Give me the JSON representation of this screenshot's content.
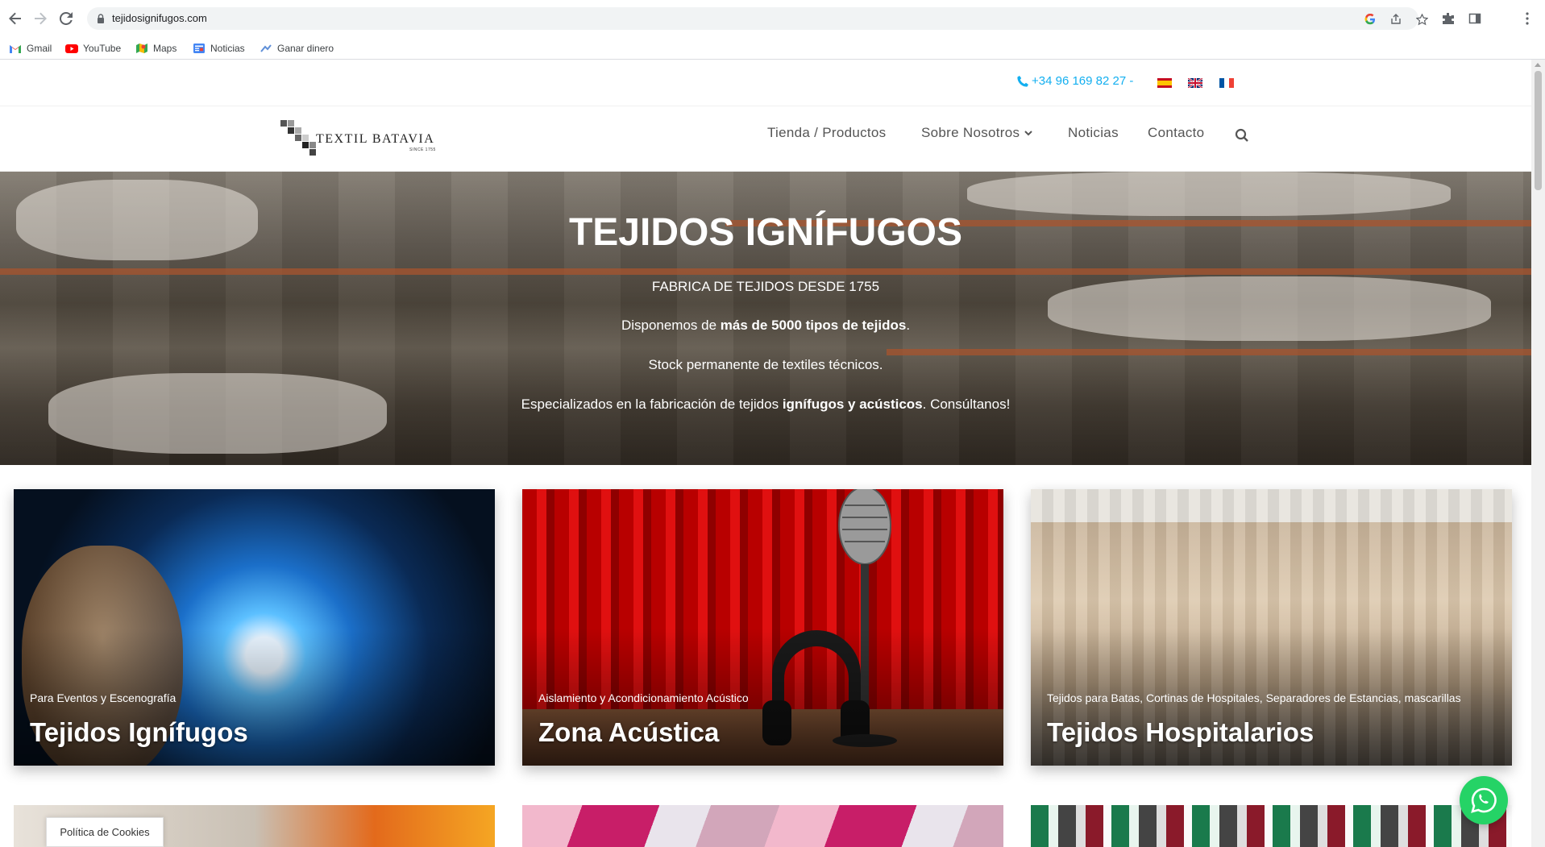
{
  "browser": {
    "url": "tejidosignifugos.com",
    "bookmarks": [
      "Gmail",
      "YouTube",
      "Maps",
      "Noticias",
      "Ganar dinero"
    ]
  },
  "topbar": {
    "phone": "+34 96 169 82 27 -",
    "flags": [
      "es-flag",
      "uk-flag",
      "fr-flag"
    ]
  },
  "header": {
    "logo_text": "TEXTIL BATAVIA",
    "logo_sub": "SINCE 1755",
    "menu": [
      "Tienda / Productos",
      "Sobre Nosotros",
      "Noticias",
      "Contacto"
    ]
  },
  "hero": {
    "title": "TEJIDOS IGNÍFUGOS",
    "line1": "FABRICA DE TEJIDOS DESDE 1755",
    "line2_pre": "Disponemos de ",
    "line2_bold": "más de 5000 tipos de tejidos",
    "line2_post": ".",
    "line3": "Stock permanente de textiles técnicos.",
    "line4_pre": "Especializados en la fabricación de tejidos ",
    "line4_bold": "ignífugos y acústicos",
    "line4_post": ". Consúltanos!"
  },
  "cards": [
    {
      "subtitle": "Para Eventos y Escenografía",
      "title": "Tejidos Ignífugos"
    },
    {
      "subtitle": "Aislamiento y Acondicionamiento Acústico",
      "title": "Zona Acústica"
    },
    {
      "subtitle": "Tejidos para Batas, Cortinas de Hospitales, Separadores de Estancias, mascarillas",
      "title": "Tejidos Hospitalarios"
    }
  ],
  "cookies": "Política de Cookies",
  "colors": {
    "accent": "#13aff0",
    "whatsapp": "#25d366"
  }
}
